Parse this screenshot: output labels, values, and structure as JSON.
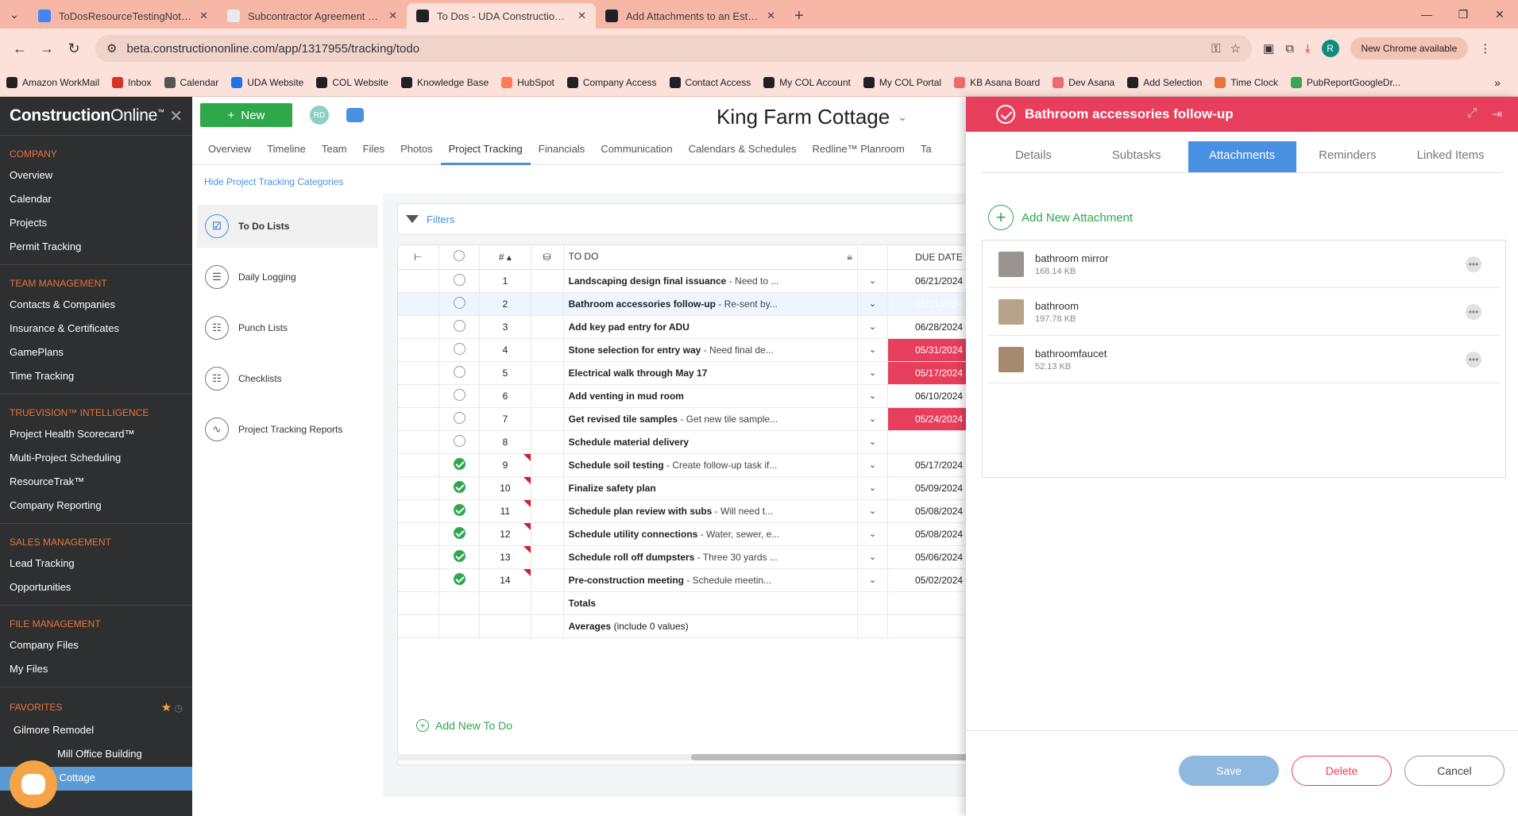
{
  "browser": {
    "tabs": [
      {
        "title": "ToDosResourceTestingNotes - G",
        "color": "#4285f4"
      },
      {
        "title": "Subcontractor Agreement for S",
        "color": "#e8eaed"
      },
      {
        "title": "To Dos - UDA ConstructionOnli",
        "color": "#202124"
      },
      {
        "title": "Add Attachments to an Estimat",
        "color": "#202124"
      }
    ],
    "active_tab": 2,
    "url": "beta.constructiononline.com/app/1317955/tracking/todo",
    "new_chrome": "New Chrome available",
    "profile_letter": "R",
    "bookmarks": [
      {
        "label": "Amazon WorkMail",
        "color": "#222"
      },
      {
        "label": "Inbox",
        "color": "#d93025"
      },
      {
        "label": "Calendar",
        "color": "#555"
      },
      {
        "label": "UDA Website",
        "color": "#1a73e8"
      },
      {
        "label": "COL Website",
        "color": "#202124"
      },
      {
        "label": "Knowledge Base",
        "color": "#202124"
      },
      {
        "label": "HubSpot",
        "color": "#ff7a59"
      },
      {
        "label": "Company Access",
        "color": "#202124"
      },
      {
        "label": "Contact Access",
        "color": "#202124"
      },
      {
        "label": "My COL Account",
        "color": "#202124"
      },
      {
        "label": "My COL Portal",
        "color": "#202124"
      },
      {
        "label": "KB Asana Board",
        "color": "#f06a6a"
      },
      {
        "label": "Dev Asana",
        "color": "#f06a6a"
      },
      {
        "label": "Add Selection",
        "color": "#202124"
      },
      {
        "label": "Time Clock",
        "color": "#e8743b"
      },
      {
        "label": "PubReportGoogleDr...",
        "color": "#34a853"
      }
    ]
  },
  "sidebar": {
    "logo_a": "Construction",
    "logo_b": "Online",
    "tm": "™",
    "company_head": "COMPANY",
    "company": [
      "Overview",
      "Calendar",
      "Projects",
      "Permit Tracking"
    ],
    "team_head": "TEAM MANAGEMENT",
    "team": [
      "Contacts & Companies",
      "Insurance & Certificates",
      "GamePlans",
      "Time Tracking"
    ],
    "tv_head": "TRUEVISION™ INTELLIGENCE",
    "tv": [
      "Project Health Scorecard™",
      "Multi-Project Scheduling",
      "ResourceTrak™",
      "Company Reporting"
    ],
    "sales_head": "SALES MANAGEMENT",
    "sales": [
      "Lead Tracking",
      "Opportunities"
    ],
    "file_head": "FILE MANAGEMENT",
    "file": [
      "Company Files",
      "My Files"
    ],
    "fav_head": "FAVORITES",
    "fav": [
      "Gilmore Remodel",
      "Mill Office Building",
      "m Cottage"
    ]
  },
  "main": {
    "new_label": "New",
    "initials": "RD",
    "project_title": "King Farm Cottage",
    "tabs": [
      "Overview",
      "Timeline",
      "Team",
      "Files",
      "Photos",
      "Project Tracking",
      "Financials",
      "Communication",
      "Calendars & Schedules",
      "Redline™ Planroom",
      "Ta"
    ],
    "active_tab": 5,
    "hide_link": "Hide Project Tracking Categories",
    "categories": [
      "To Do Lists",
      "Daily Logging",
      "Punch Lists",
      "Checklists",
      "Project Tracking Reports"
    ],
    "filters": "Filters",
    "col_num": "#",
    "col_todo": "TO DO",
    "col_due": "DUE DATE",
    "rows": [
      {
        "n": "1",
        "title": "Landscaping design final issuance",
        "desc": " - Need to ...",
        "due": "06/21/2024",
        "over": false,
        "done": false,
        "prio": "low",
        "clip": false
      },
      {
        "n": "2",
        "title": "Bathroom accessories follow-up",
        "desc": " - Re-sent by...",
        "due": "05/31/2024",
        "over": true,
        "done": false,
        "prio": "high",
        "clip": true
      },
      {
        "n": "3",
        "title": "Add key pad entry for ADU",
        "desc": "",
        "due": "06/28/2024",
        "over": false,
        "done": false,
        "prio": "low",
        "clip": false
      },
      {
        "n": "4",
        "title": "Stone selection for entry way",
        "desc": " - Need final de...",
        "due": "05/31/2024",
        "over": true,
        "done": false,
        "prio": "high",
        "clip": false
      },
      {
        "n": "5",
        "title": "Electrical walk through May 17",
        "desc": "",
        "due": "05/17/2024",
        "over": true,
        "done": false,
        "prio": "high",
        "clip": false
      },
      {
        "n": "6",
        "title": "Add venting in mud room",
        "desc": "",
        "due": "06/10/2024",
        "over": false,
        "done": false,
        "prio": "med",
        "clip": false
      },
      {
        "n": "7",
        "title": "Get revised tile samples",
        "desc": " - Get new tile sample...",
        "due": "05/24/2024",
        "over": true,
        "done": false,
        "prio": "low",
        "clip": true
      },
      {
        "n": "8",
        "title": "Schedule material delivery",
        "desc": "",
        "due": "",
        "over": false,
        "done": false,
        "prio": "none",
        "clip": false
      },
      {
        "n": "9",
        "title": "Schedule soil testing",
        "desc": " - Create follow-up task if...",
        "due": "05/17/2024",
        "over": false,
        "done": true,
        "prio": "med",
        "clip": false
      },
      {
        "n": "10",
        "title": "Finalize safety plan",
        "desc": "",
        "due": "05/09/2024",
        "over": false,
        "done": true,
        "prio": "high",
        "clip": false
      },
      {
        "n": "11",
        "title": "Schedule plan review with subs",
        "desc": " - Will need t...",
        "due": "05/08/2024",
        "over": false,
        "done": true,
        "prio": "high",
        "clip": false
      },
      {
        "n": "12",
        "title": "Schedule utility connections",
        "desc": " - Water, sewer, e...",
        "due": "05/08/2024",
        "over": false,
        "done": true,
        "prio": "med",
        "clip": false
      },
      {
        "n": "13",
        "title": "Schedule roll off dumpsters",
        "desc": " - Three 30 yards ...",
        "due": "05/06/2024",
        "over": false,
        "done": true,
        "prio": "high",
        "clip": false
      },
      {
        "n": "14",
        "title": "Pre-construction meeting",
        "desc": " - Schedule meetin...",
        "due": "05/02/2024",
        "over": false,
        "done": true,
        "prio": "med",
        "clip": false
      }
    ],
    "totals": "Totals",
    "averages": "Averages",
    "averages_note": " (include 0 values)",
    "add_todo": "Add New To Do"
  },
  "panel": {
    "title": "Bathroom accessories follow-up",
    "tabs": [
      "Details",
      "Subtasks",
      "Attachments",
      "Reminders",
      "Linked Items"
    ],
    "active_tab": 2,
    "add_attachment": "Add New Attachment",
    "attachments": [
      {
        "name": "bathroom mirror",
        "size": "168.14 KB",
        "color": "#9a9490"
      },
      {
        "name": "bathroom",
        "size": "197.78 KB",
        "color": "#b7a38a"
      },
      {
        "name": "bathroomfaucet",
        "size": "52.13 KB",
        "color": "#a68a70"
      }
    ],
    "save": "Save",
    "delete": "Delete",
    "cancel": "Cancel"
  }
}
